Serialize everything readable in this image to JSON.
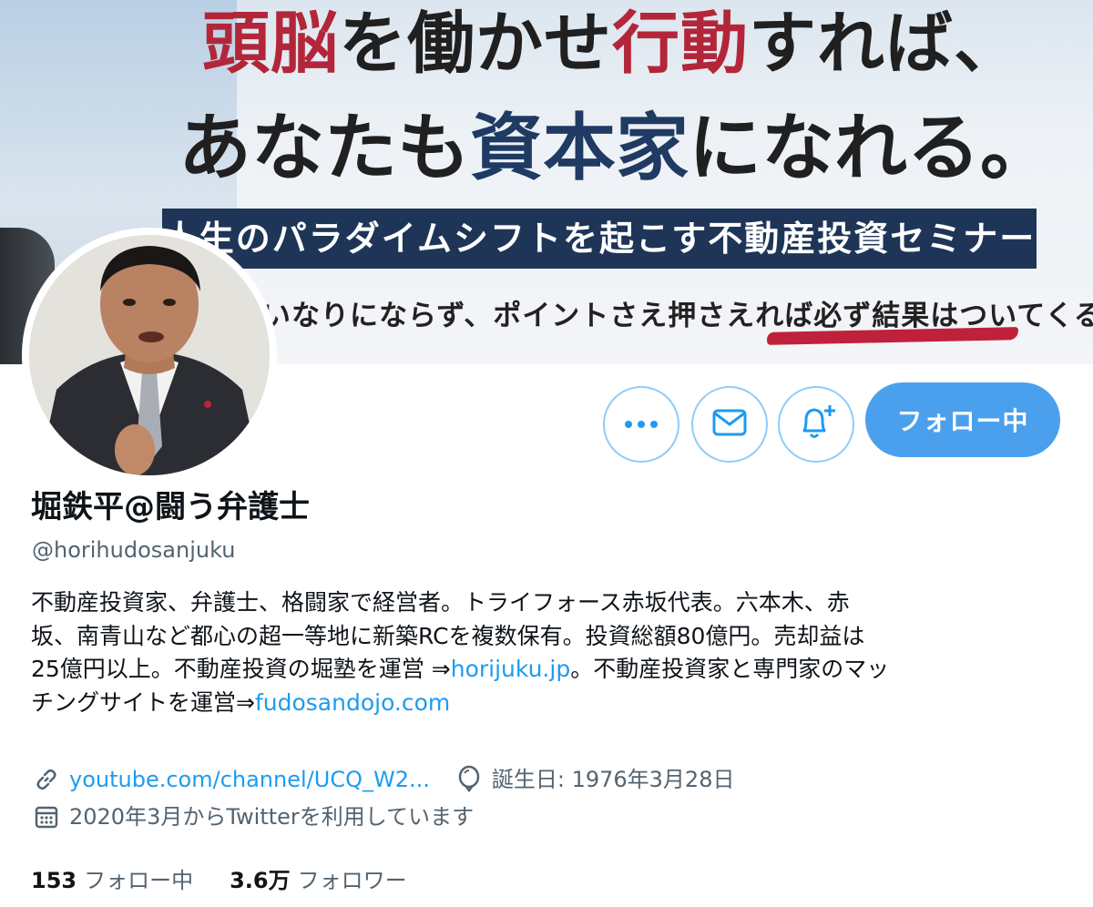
{
  "banner": {
    "headline1": [
      "頭脳",
      "を働かせ",
      "行動",
      "すれば、"
    ],
    "headline2": [
      "あなたも",
      "資本家",
      "になれる。"
    ],
    "ribbon": "人生のパラダイムシフトを起こす不動産投資セミナー",
    "subline": "いなりにならず、ポイントさえ押さえれば必ず結果はついてくる。"
  },
  "profile": {
    "name": "堀鉄平@闘う弁護士",
    "handle": "@horihudosanjuku",
    "bio_lines": [
      "不動産投資家、弁護士、格闘家で経営者。トライフォース赤坂代表。六本木、赤",
      "坂、南青山など都心の超一等地に新築RCを複数保有。投資総額80億円。売却益は"
    ],
    "bio_line3_pre": "25億円以上。不動産投資の堀塾を運営 ⇒",
    "bio_link1": "horijuku.jp",
    "bio_line3_post": "。不動産投資家と専門家のマッ",
    "bio_line4_pre": "チングサイトを運営⇒",
    "bio_link2": "fudosandojo.com",
    "website": "youtube.com/channel/UCQ_W2...",
    "birthday": "誕生日: 1976年3月28日",
    "joined": "2020年3月からTwitterを利用しています"
  },
  "actions": {
    "more_icon": "more-icon",
    "message_icon": "message-icon",
    "notify_icon": "notification-bell-icon",
    "follow_label": "フォロー中"
  },
  "stats": {
    "following_count": "153",
    "following_label": "フォロー中",
    "followers_count": "3.6万",
    "followers_label": "フォロワー"
  },
  "colors": {
    "accent": "#1d9bf0",
    "follow_button": "#4aa0ec",
    "icon_border": "#8ecdf8",
    "secondary_text": "#536471",
    "banner_red": "#b3263a",
    "banner_navy": "#1e3558"
  }
}
